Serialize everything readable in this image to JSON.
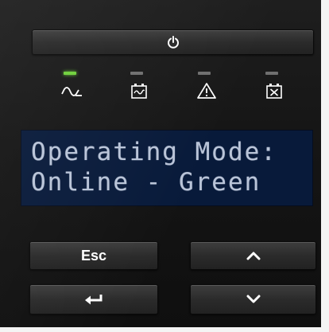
{
  "panel": {
    "power_icon": "power-icon",
    "indicators": [
      {
        "name": "ac-line-indicator",
        "icon": "sine-wave-icon",
        "led_color": "#6fd13b",
        "active": true
      },
      {
        "name": "battery-indicator",
        "icon": "battery-icon",
        "led_color": "#7a7a7a",
        "active": false
      },
      {
        "name": "alarm-indicator",
        "icon": "warning-icon",
        "led_color": "#7a7a7a",
        "active": false
      },
      {
        "name": "battery-fault-indicator",
        "icon": "battery-fault-icon",
        "led_color": "#7a7a7a",
        "active": false
      }
    ]
  },
  "lcd": {
    "line1": "Operating Mode:",
    "line2": "Online - Green",
    "background": "#081a3a",
    "text_color": "#b9c4d8"
  },
  "buttons": {
    "esc_label": "Esc",
    "enter_icon": "enter-arrow-icon",
    "up_icon": "chevron-up-icon",
    "down_icon": "chevron-down-icon"
  }
}
